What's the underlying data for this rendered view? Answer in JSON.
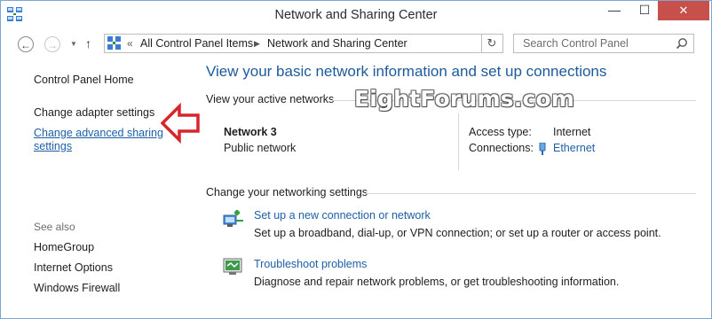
{
  "window": {
    "title": "Network and Sharing Center"
  },
  "address": {
    "crumbs": [
      "All Control Panel Items",
      "Network and Sharing Center"
    ],
    "search_placeholder": "Search Control Panel"
  },
  "sidebar": {
    "home": "Control Panel Home",
    "adapter": "Change adapter settings",
    "advanced_line1": "Change advanced sharing",
    "advanced_line2": "settings",
    "see_also": "See also",
    "links": [
      "HomeGroup",
      "Internet Options",
      "Windows Firewall"
    ]
  },
  "main": {
    "title": "View your basic network information and set up connections",
    "active_section": "View your active networks",
    "network_name": "Network  3",
    "network_type": "Public network",
    "access_label": "Access type:",
    "access_value": "Internet",
    "connections_label": "Connections:",
    "connections_value": "Ethernet",
    "watermark": "EightForums.com",
    "change_section": "Change your networking settings",
    "tasks": [
      {
        "link": "Set up a new connection or network",
        "desc": "Set up a broadband, dial-up, or VPN connection; or set up a router or access point.",
        "icon": "new-connection-icon"
      },
      {
        "link": "Troubleshoot problems",
        "desc": "Diagnose and repair network problems, or get troubleshooting information.",
        "icon": "troubleshoot-icon"
      }
    ]
  },
  "colors": {
    "title_blue": "#1d5a9b",
    "link_blue": "#1e5fa8",
    "close_red": "#c7504a",
    "arrow_red": "#d6262b"
  }
}
